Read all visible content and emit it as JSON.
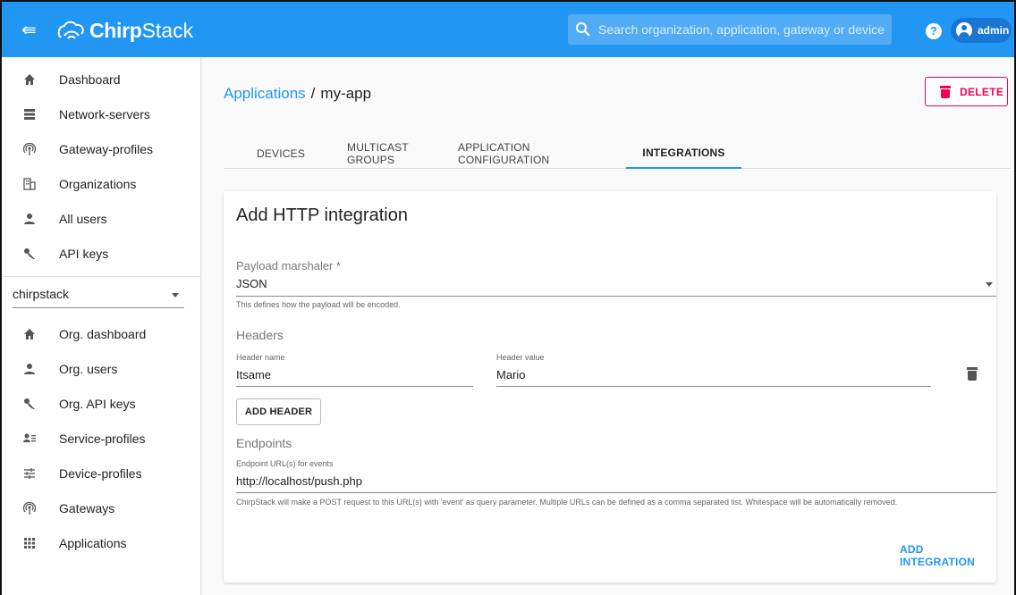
{
  "app": {
    "brand_bold": "Chirp",
    "brand_normal": "Stack",
    "accent_color": "#2196f3",
    "danger_color": "#f50057"
  },
  "topbar": {
    "search_placeholder": "Search organization, application, gateway or device",
    "help_icon": "?",
    "user_label": "admin"
  },
  "sidebar": {
    "global_items": [
      {
        "label": "Dashboard",
        "icon": "home-icon"
      },
      {
        "label": "Network-servers",
        "icon": "server-icon"
      },
      {
        "label": "Gateway-profiles",
        "icon": "radio-tower-icon"
      },
      {
        "label": "Organizations",
        "icon": "domain-icon"
      },
      {
        "label": "All users",
        "icon": "person-icon"
      },
      {
        "label": "API keys",
        "icon": "key-icon"
      }
    ],
    "org_select_value": "chirpstack",
    "org_items": [
      {
        "label": "Org. dashboard",
        "icon": "home-icon"
      },
      {
        "label": "Org. users",
        "icon": "person-icon"
      },
      {
        "label": "Org. API keys",
        "icon": "key-icon"
      },
      {
        "label": "Service-profiles",
        "icon": "account-details-icon"
      },
      {
        "label": "Device-profiles",
        "icon": "tune-icon"
      },
      {
        "label": "Gateways",
        "icon": "radio-tower-icon"
      },
      {
        "label": "Applications",
        "icon": "apps-grid-icon"
      }
    ]
  },
  "main": {
    "breadcrumb": {
      "parent": "Applications",
      "separator": "/",
      "current": "my-app"
    },
    "delete_label": "DELETE",
    "tabs": [
      {
        "label": "DEVICES",
        "active": false
      },
      {
        "label": "MULTICAST GROUPS",
        "active": false
      },
      {
        "label": "APPLICATION CONFIGURATION",
        "active": false
      },
      {
        "label": "INTEGRATIONS",
        "active": true
      }
    ],
    "card": {
      "title": "Add HTTP integration",
      "payload_marshaler_label": "Payload marshaler *",
      "payload_marshaler_value": "JSON",
      "payload_marshaler_helper": "This defines how the payload will be encoded.",
      "headers_label": "Headers",
      "header_name_label": "Header name",
      "header_name_value": "Itsame",
      "header_value_label": "Header value",
      "header_value_value": "Mario",
      "add_header_label": "ADD HEADER",
      "endpoints_label": "Endpoints",
      "endpoint_label": "Endpoint URL(s) for events",
      "endpoint_value": "http://localhost/push.php",
      "endpoint_helper": "ChirpStack will make a POST request to this URL(s) with 'event' as query parameter. Multiple URLs can be defined as a comma separated list. Whitespace will be automatically removed.",
      "add_integration_label": "ADD INTEGRATION"
    }
  }
}
